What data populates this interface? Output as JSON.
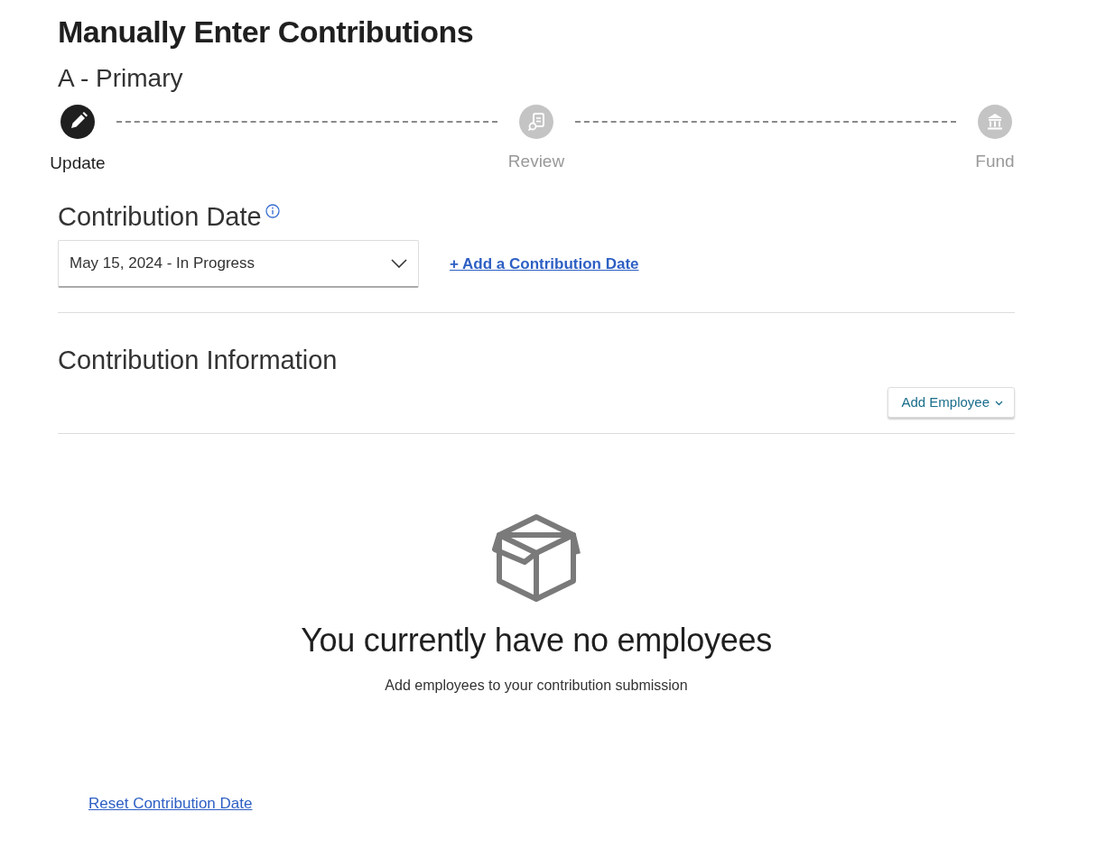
{
  "page": {
    "title": "Manually Enter Contributions",
    "subtitle": "A - Primary"
  },
  "steps": [
    {
      "label": "Update",
      "kind": "edit",
      "selected": true
    },
    {
      "label": "Review",
      "kind": "review",
      "selected": false
    },
    {
      "label": "Fund",
      "kind": "bank",
      "selected": false
    }
  ],
  "contribution_date": {
    "heading": "Contribution Date",
    "value": "May 15, 2024 - In Progress",
    "add_link": "+ Add a Contribution Date"
  },
  "contribution_information": {
    "heading": "Contribution Information",
    "add_button": "Add Employee"
  },
  "empty_state": {
    "heading": "You currently have no employees",
    "message": "Add employees to your contribution submission"
  },
  "reset_link": "Reset Contribution Date"
}
